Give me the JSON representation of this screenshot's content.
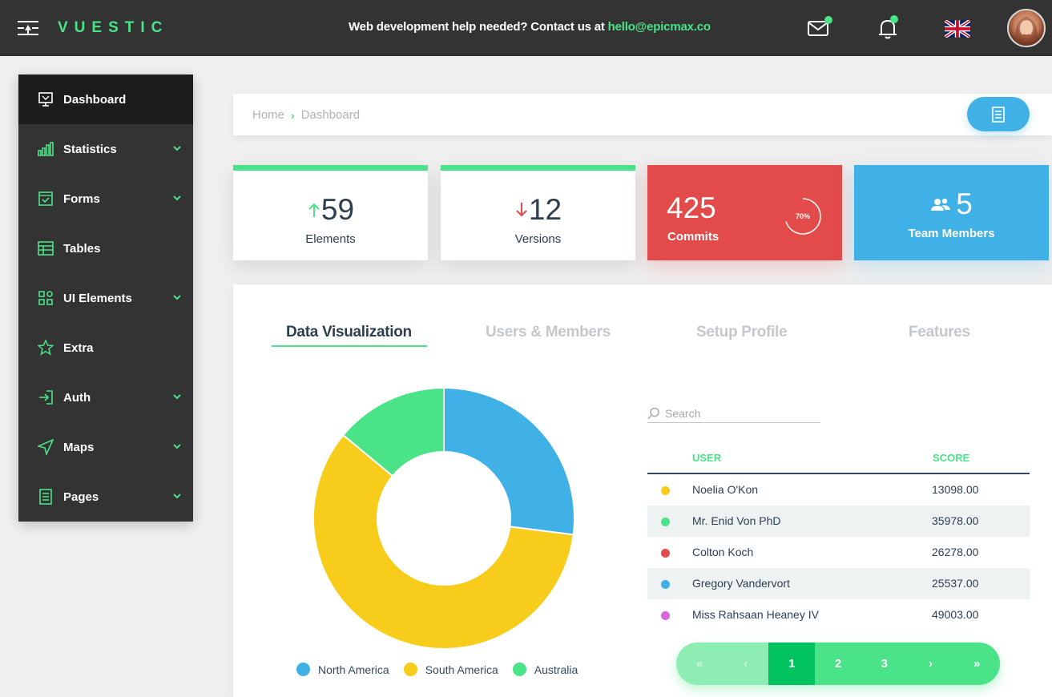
{
  "header": {
    "logo": "VUESTIC",
    "help_text": "Web development help needed? Contact us at ",
    "help_email": "hello@epicmax.co"
  },
  "sidebar": {
    "items": [
      {
        "label": "Dashboard",
        "icon": "monitor-icon",
        "expandable": false,
        "active": true
      },
      {
        "label": "Statistics",
        "icon": "bar-chart-icon",
        "expandable": true
      },
      {
        "label": "Forms",
        "icon": "checkbox-form-icon",
        "expandable": true
      },
      {
        "label": "Tables",
        "icon": "table-icon",
        "expandable": false
      },
      {
        "label": "UI Elements",
        "icon": "grid-icon",
        "expandable": true
      },
      {
        "label": "Extra",
        "icon": "star-icon",
        "expandable": false
      },
      {
        "label": "Auth",
        "icon": "login-icon",
        "expandable": true
      },
      {
        "label": "Maps",
        "icon": "navigation-icon",
        "expandable": true
      },
      {
        "label": "Pages",
        "icon": "document-icon",
        "expandable": true
      }
    ]
  },
  "breadcrumb": {
    "home": "Home",
    "current": "Dashboard"
  },
  "stats": {
    "elements": {
      "value": "59",
      "label": "Elements",
      "trend": "up"
    },
    "versions": {
      "value": "12",
      "label": "Versions",
      "trend": "down"
    },
    "commits": {
      "value": "425",
      "label": "Commits",
      "progress": "70%"
    },
    "team": {
      "value": "5",
      "label": "Team Members"
    }
  },
  "tabs": [
    "Data Visualization",
    "Users & Members",
    "Setup Profile",
    "Features"
  ],
  "donut": {
    "series": [
      {
        "name": "North America",
        "value": 27,
        "color": "#40b1e6"
      },
      {
        "name": "South America",
        "value": 59,
        "color": "#f7cc1a"
      },
      {
        "name": "Australia",
        "value": 14,
        "color": "#4ae387"
      }
    ]
  },
  "search": {
    "placeholder": "Search"
  },
  "table": {
    "headers": [
      "USER",
      "SCORE"
    ],
    "rows": [
      {
        "name": "Noelia O'Kon",
        "score": "13098.00",
        "color": "#f7cc1a"
      },
      {
        "name": "Mr. Enid Von PhD",
        "score": "35978.00",
        "color": "#4ae387"
      },
      {
        "name": "Colton Koch",
        "score": "26278.00",
        "color": "#e34a4a"
      },
      {
        "name": "Gregory Vandervort",
        "score": "25537.00",
        "color": "#40b1e6"
      },
      {
        "name": "Miss Rahsaan Heaney IV",
        "score": "49003.00",
        "color": "#d866e0"
      }
    ]
  },
  "pagination": {
    "first": "«",
    "prev": "‹",
    "pages": [
      "1",
      "2",
      "3"
    ],
    "next": "›",
    "last": "»",
    "current": "1"
  }
}
